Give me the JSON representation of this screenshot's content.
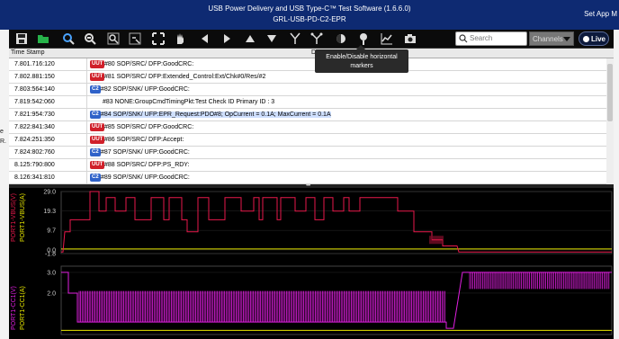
{
  "window": {
    "title_line1": "USB Power Delivery and USB Type-C™ Test Software (1.6.6.0)",
    "title_line2": "GRL-USB-PD-C2-EPR",
    "right_text": "Set App M"
  },
  "left_strip": [
    "e",
    "R."
  ],
  "toolbar": {
    "icons": [
      "save-icon",
      "open-folder-icon",
      "zoom-fit-icon",
      "zoom-out-icon",
      "zoom-in-area-icon",
      "zoom-out-area-icon",
      "fit-screen-icon",
      "hand-pan-icon",
      "arrow-left-icon",
      "arrow-right-icon",
      "arrow-up-icon",
      "arrow-down-icon",
      "split-icon",
      "merge-icon",
      "vertical-marker-icon",
      "horizontal-marker-icon",
      "chart-icon",
      "camera-icon"
    ],
    "search_placeholder": "Search",
    "channels_label": "Channels",
    "live_label": "Live"
  },
  "tooltip": {
    "line1": "Enable/Disable horizontal",
    "line2": "markers"
  },
  "table": {
    "col_timestamp": "Time Stamp",
    "col_desc": "D",
    "rows": [
      {
        "ts": "7.801.716:120",
        "badge": "UUT",
        "msg": "#80 SOP/SRC/ DFP:GoodCRC:"
      },
      {
        "ts": "7.802.881:150",
        "badge": "UUT",
        "msg": "#81 SOP/SRC/ DFP:Extended_Control:Ext/Chk#0/Res/#2"
      },
      {
        "ts": "7.803:564:140",
        "badge": "C2",
        "msg": "#82 SOP/SNK/ UFP:GoodCRC:"
      },
      {
        "ts": "7.819:542:060",
        "badge": "",
        "msg": "#83 NONE:GroupCmdTimingPkt:Test Check ID Primary ID : 3"
      },
      {
        "ts": "7.821:954:730",
        "badge": "C2",
        "msg": "#84 SOP/SNK/ UFP:EPR_Request:PDO#8; OpCurrent = 0.1A; MaxCurrent = 0.1A",
        "selected": true
      },
      {
        "ts": "7.822:841:340",
        "badge": "UUT",
        "msg": "#85 SOP/SRC/ DFP:GoodCRC:"
      },
      {
        "ts": "7.824:251:350",
        "badge": "UUT",
        "msg": "#86 SOP/SRC/ DFP:Accept:"
      },
      {
        "ts": "7.824:802:760",
        "badge": "C2",
        "msg": "#87 SOP/SNK/ UFP:GoodCRC:"
      },
      {
        "ts": "8.125:790:800",
        "badge": "UUT",
        "msg": "#88 SOP/SRC/ DFP:PS_RDY:"
      },
      {
        "ts": "8.126:341:810",
        "badge": "C2",
        "msg": "#89 SOP/SNK/ UFP:GoodCRC:"
      }
    ]
  },
  "chart_data": [
    {
      "type": "line",
      "series": [
        {
          "name": "PORT1-VBUS(V)",
          "color": "#e8194b"
        },
        {
          "name": "PORT1-VBUS(A)",
          "color": "#e8e800"
        }
      ],
      "y_ticks": [
        "29.0",
        "19.3",
        "9.7",
        "0.0",
        "-1.8"
      ],
      "ylim": [
        -1.8,
        29.0
      ]
    },
    {
      "type": "line",
      "series": [
        {
          "name": "PORT1-CC1(V)",
          "color": "#e01fe0"
        },
        {
          "name": "PORT1-CC1(A)",
          "color": "#e8e800"
        }
      ],
      "y_ticks": [
        "3.0",
        "2.0"
      ],
      "ylim": [
        0,
        3.3
      ]
    }
  ]
}
